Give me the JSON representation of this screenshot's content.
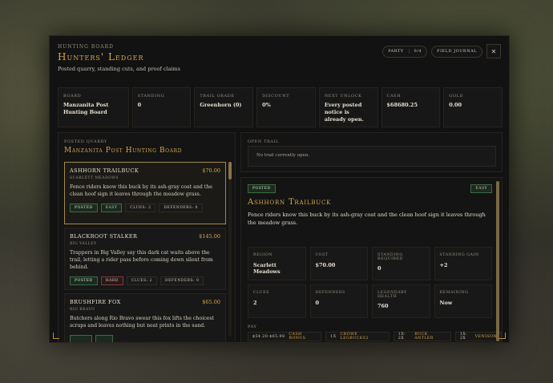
{
  "header": {
    "eyebrow": "Hunting Board",
    "title": "Hunters' Ledger",
    "subtitle": "Posted quarry, standing cuts, and proof claims",
    "party_label": "Party",
    "party_value": "0/4",
    "journal_label": "Field Journal",
    "close_glyph": "✕"
  },
  "stats": [
    {
      "label": "Board",
      "value": "Manzanita Post Hunting Board"
    },
    {
      "label": "Standing",
      "value": "0"
    },
    {
      "label": "Trail Grade",
      "value": "Greenhorn (0)"
    },
    {
      "label": "Discount",
      "value": "0%"
    },
    {
      "label": "Next Unlock",
      "value": "Every posted notice is already open."
    },
    {
      "label": "Cash",
      "value": "$68680.25"
    },
    {
      "label": "Gold",
      "value": "0.00"
    }
  ],
  "board": {
    "eyebrow": "Posted Quarry",
    "title": "Manzanita Post Hunting Board",
    "items": [
      {
        "name": "Ashhorn Trailbuck",
        "price": "$70.00",
        "region": "Scarlett Meadows",
        "desc": "Fence riders know this buck by its ash-gray coat and the clean hoof sign it leaves through the meadow grass.",
        "status": "Posted",
        "difficulty": "Easy",
        "clues": "Clues: 2",
        "defenders": "Defenders: 0"
      },
      {
        "name": "Blackroot Stalker",
        "price": "$145.00",
        "region": "Big Valley",
        "desc": "Trappers in Big Valley say this dark cat waits above the trail, letting a rider pass before coming down silent from behind.",
        "status": "Posted",
        "difficulty": "Hard",
        "clues": "Clues: 2",
        "defenders": "Defenders: 0"
      },
      {
        "name": "Brushfire Fox",
        "price": "$65.00",
        "region": "Rio Bravo",
        "desc": "Butchers along Rio Bravo swear this fox lifts the choicest scraps and leaves nothing but neat prints in the sand.",
        "status": "",
        "difficulty": "",
        "clues": "",
        "defenders": ""
      }
    ]
  },
  "trail": {
    "label": "Open Trail",
    "empty": "No trail currently open."
  },
  "detail": {
    "status": "Posted",
    "difficulty": "Easy",
    "title": "Ashhorn Trailbuck",
    "desc": "Fence riders know this buck by its ash-gray coat and the clean hoof sign it leaves through the meadow grass.",
    "cells": [
      {
        "label": "Region",
        "value": "Scarlett Meadows"
      },
      {
        "label": "Cost",
        "value": "$70.00"
      },
      {
        "label": "Standing Required",
        "value": "0"
      },
      {
        "label": "Standing Gain",
        "value": "+2"
      },
      {
        "label": "Clues",
        "value": "2"
      },
      {
        "label": "Defenders",
        "value": "0"
      },
      {
        "label": "Legendary Health",
        "value": "760"
      },
      {
        "label": "Remaining",
        "value": "Now"
      }
    ],
    "pay_label": "Pay",
    "pay": [
      {
        "amount": "$54.20-$65.98",
        "name": "Cash Bonus"
      },
      {
        "amount": "1x",
        "name": "Crowe Legbucks2"
      },
      {
        "amount": "1x-2x",
        "name": "Buck Antler"
      },
      {
        "amount": "1x-2x",
        "name": "Venison"
      }
    ]
  }
}
